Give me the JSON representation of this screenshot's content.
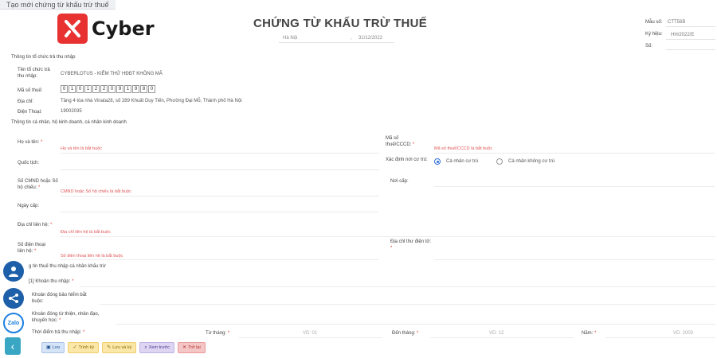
{
  "tab": {
    "title": "Tạo mới chứng từ khấu trừ thuế"
  },
  "brand": {
    "name": "Cyber",
    "tm": "™",
    "color": "#e83232"
  },
  "document": {
    "title": "CHỨNG TỪ KHẤU TRỪ THUẾ",
    "place": "Hà Nội",
    "separator": ",",
    "date": "31/12/2022"
  },
  "meta": {
    "form_label": "Mẫu số:",
    "form_value": "CTT56B",
    "symbol_label": "Ký hiệu:",
    "symbol_value": "HH/2022/E",
    "number_label": "Số:"
  },
  "payer": {
    "section": "Thông tin tổ chức trả thu nhập",
    "name_label": "Tên tổ chức trả thu nhập:",
    "name_value": "CYBERLOTUS - KIỂM THỬ HĐĐT KHÔNG MÃ",
    "tax_label": "Mã số thuế:",
    "tax_digits": [
      "0",
      "1",
      "0",
      "1",
      "2",
      "2",
      "0",
      "9",
      "1",
      "9",
      "8",
      "0"
    ],
    "address_label": "Địa chỉ:",
    "address_value": "Tầng 4 tòa nhà Vinata28, số 289 Khuất Duy Tiến, Phường Đại Mỗ, Thành phố Hà Nội",
    "phone_label": "Điện Thoại:",
    "phone_value": "19002035"
  },
  "person": {
    "section": "Thông tin cá nhân, hộ kinh doanh, cá nhân kinh doanh",
    "fullname_label": "Họ và tên:",
    "fullname_placeholder": "Họ và tên là bắt buộc",
    "taxid_label": "Mã số thuế/CCCD:",
    "taxid_placeholder": "Mã số thuế/CCCD là bắt buộc",
    "nationality_label": "Quốc tịch:",
    "residence_label": "Xác định nơi cư trú:",
    "residence_opt1": "Cá nhân cư trú",
    "residence_opt2": "Cá nhân không cư trú",
    "id_label": "Số CMND hoặc Số hộ chiếu:",
    "id_placeholder": "CMND hoặc Số hộ chiếu là bắt buộc",
    "issue_place_label": "Nơi cấp:",
    "issue_date_label": "Ngày cấp:",
    "contact_address_label": "Địa chỉ liên hệ:",
    "contact_address_placeholder": "Địa chỉ liên hệ là bắt buộc",
    "phone_label": "Số điện thoại liên hệ:",
    "phone_placeholder": "Số điện thoại liên hệ là bắt buộc",
    "email_label": "Địa chỉ thư điện tử:",
    "required_mark": "*"
  },
  "income": {
    "section": "g tin thuế thu nhập cá nhân khấu trừ",
    "income_label": "[1] Khoản thu nhập:",
    "insurance_label": "Khoản đóng bảo hiểm bắt buộc:",
    "charity_label": "Khoản đóng từ thiện, nhân đạo, khuyến học:",
    "period_label": "Thời điểm trả thu nhập:",
    "from_month_label": "Từ tháng:",
    "from_month_value": "VD: 01",
    "to_month_label": "Đến tháng:",
    "to_month_value": "VD: 12",
    "year_label": "Năm:",
    "year_value": "VD: 2003"
  },
  "toolbar": {
    "save": "Lưu",
    "sign": "Trình ký",
    "save_sign": "Lưu và ký",
    "preview": "Xem trước",
    "back": "Trở lại"
  },
  "floating": {
    "zalo": "Zalo"
  }
}
